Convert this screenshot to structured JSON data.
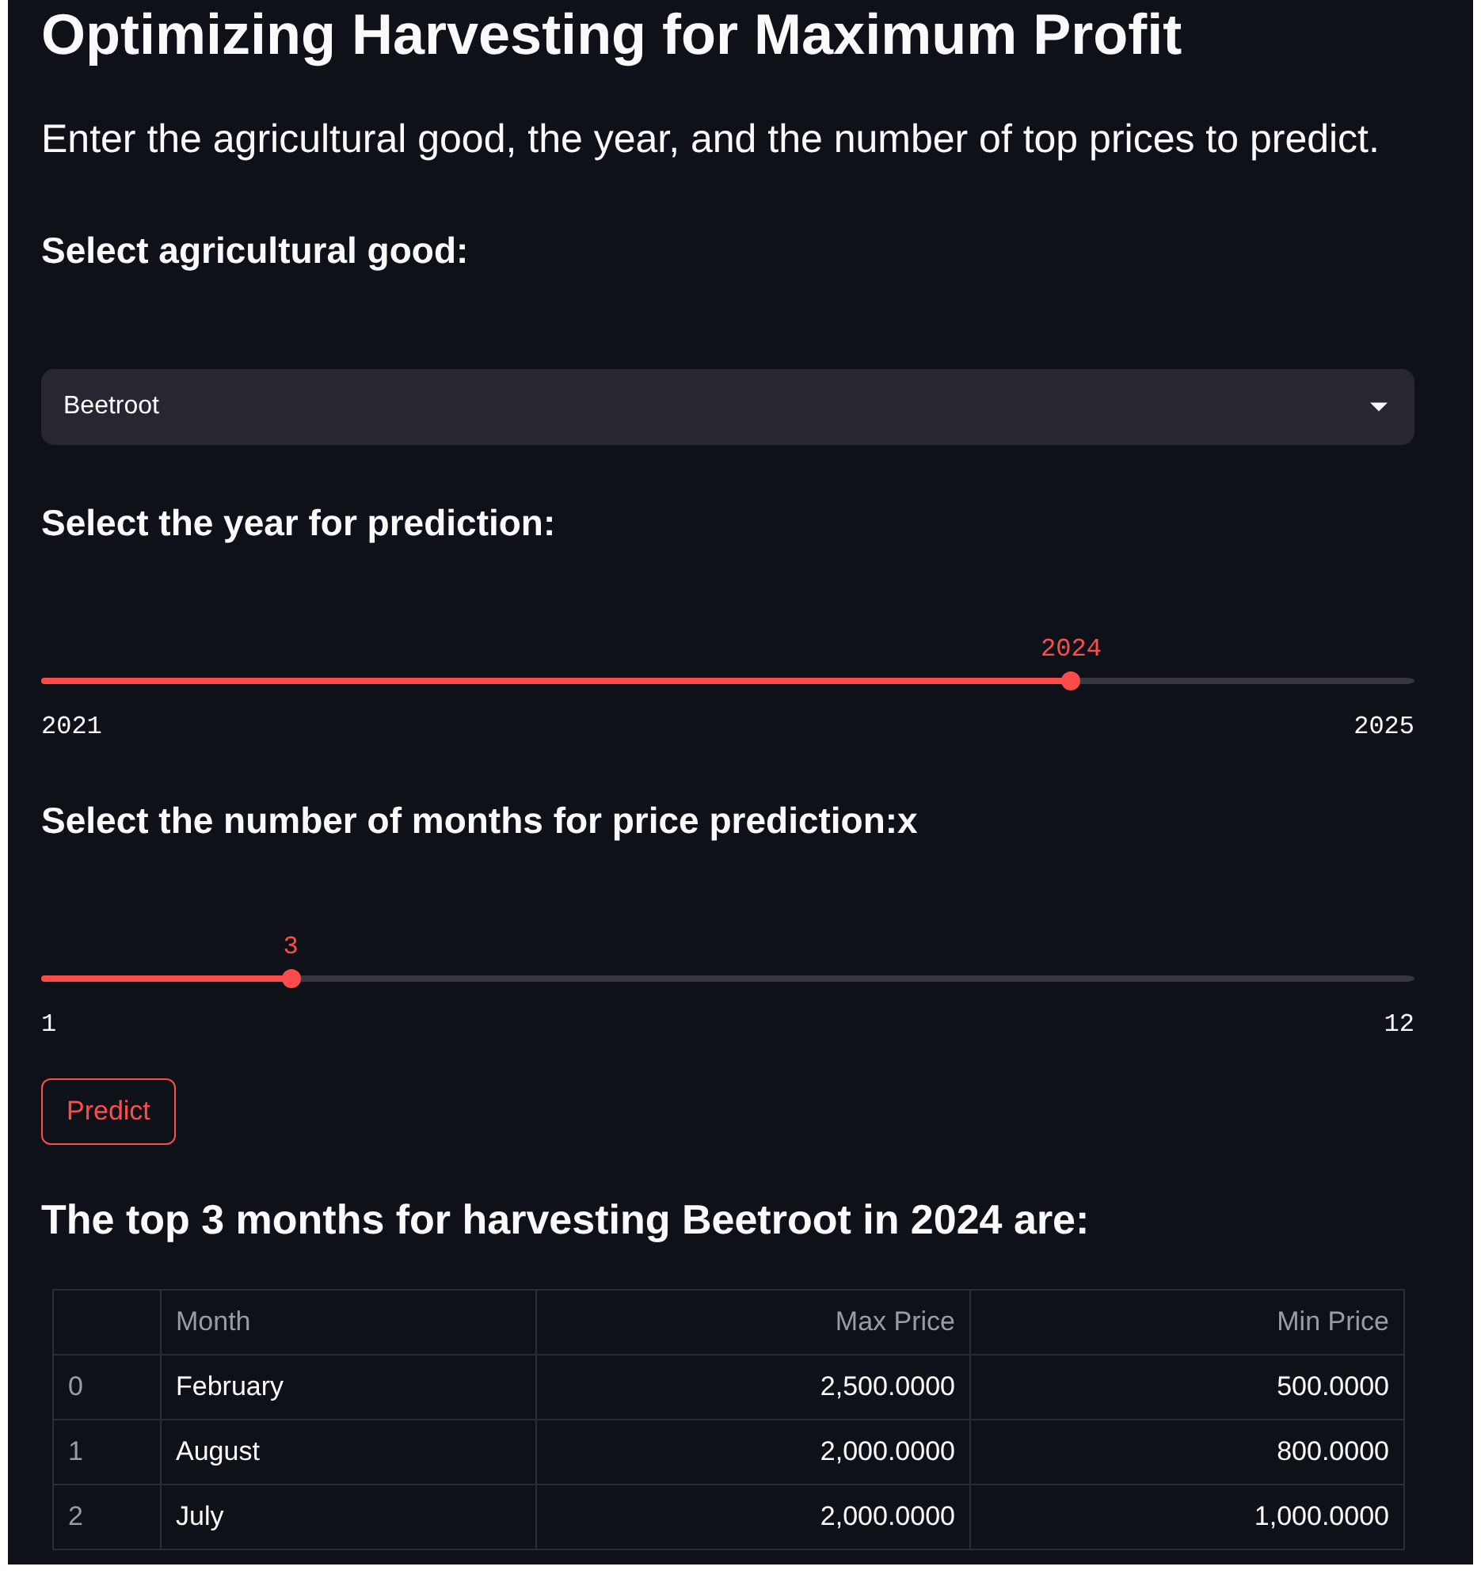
{
  "title": "Optimizing Harvesting for Maximum Profit",
  "subtitle": "Enter the agricultural good, the year, and the number of top prices to predict.",
  "widgets": [
    {
      "kind": "select",
      "label": "Select agricultural good:",
      "value": "Beetroot"
    },
    {
      "kind": "slider",
      "label": "Select the year for prediction:",
      "value": "2024",
      "min": "2021",
      "max": "2025",
      "level": 0.75
    },
    {
      "kind": "slider",
      "label": "Select the number of months for price prediction:x",
      "value": "3",
      "min": "1",
      "max": "12",
      "level": 0.1818
    },
    {
      "kind": "button",
      "label": "Predict"
    }
  ],
  "result_heading": "The top 3 months for harvesting Beetroot in 2024 are:",
  "table": {
    "columns": [
      "Month",
      "Max Price",
      "Min Price"
    ],
    "rows": [
      {
        "index": "0",
        "cells": [
          "February",
          "2,500.0000",
          "500.0000"
        ]
      },
      {
        "index": "1",
        "cells": [
          "August",
          "2,000.0000",
          "800.0000"
        ]
      },
      {
        "index": "2",
        "cells": [
          "July",
          "2,000.0000",
          "1,000.0000"
        ]
      }
    ]
  }
}
